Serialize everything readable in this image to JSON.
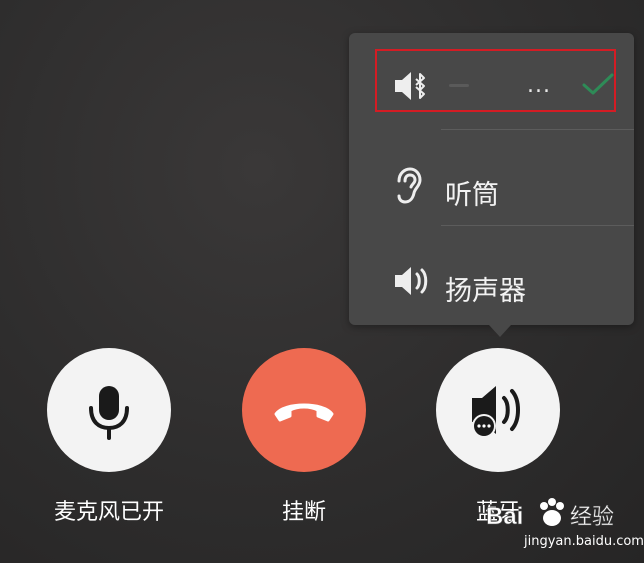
{
  "audio_menu": {
    "items": [
      {
        "label": "...",
        "icon": "speaker-bluetooth-icon",
        "selected": true
      },
      {
        "label": "听筒",
        "icon": "ear-icon",
        "selected": false
      },
      {
        "label": "扬声器",
        "icon": "speaker-icon",
        "selected": false
      }
    ],
    "highlight_color": "#d41c24",
    "check_color": "#2e8b57"
  },
  "controls": {
    "mic": {
      "label": "麦克风已开",
      "icon": "microphone-icon"
    },
    "hangup": {
      "label": "挂断",
      "icon": "phone-hangup-icon",
      "color": "#ee6a51"
    },
    "audio": {
      "label": "蓝牙",
      "icon": "speaker-more-icon"
    }
  },
  "watermark": {
    "text": "jingyan.baidu.com",
    "brand": "Bai",
    "suffix": "经验"
  }
}
